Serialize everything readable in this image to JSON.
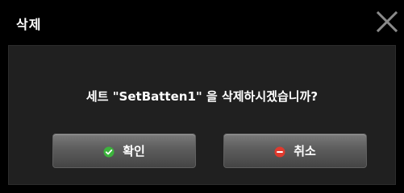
{
  "dialog": {
    "title": "삭제",
    "message": "세트 \"SetBatten1\" 을 삭제하시겠습니까?",
    "buttons": {
      "confirm_label": "확인",
      "cancel_label": "취소"
    }
  },
  "icons": {
    "close": "close-x-icon",
    "confirm": "check-circle-icon",
    "cancel": "minus-circle-icon"
  },
  "colors": {
    "background": "#000000",
    "panel": "#202020",
    "confirm_icon": "#3cb43c",
    "cancel_icon": "#e03a2e"
  }
}
